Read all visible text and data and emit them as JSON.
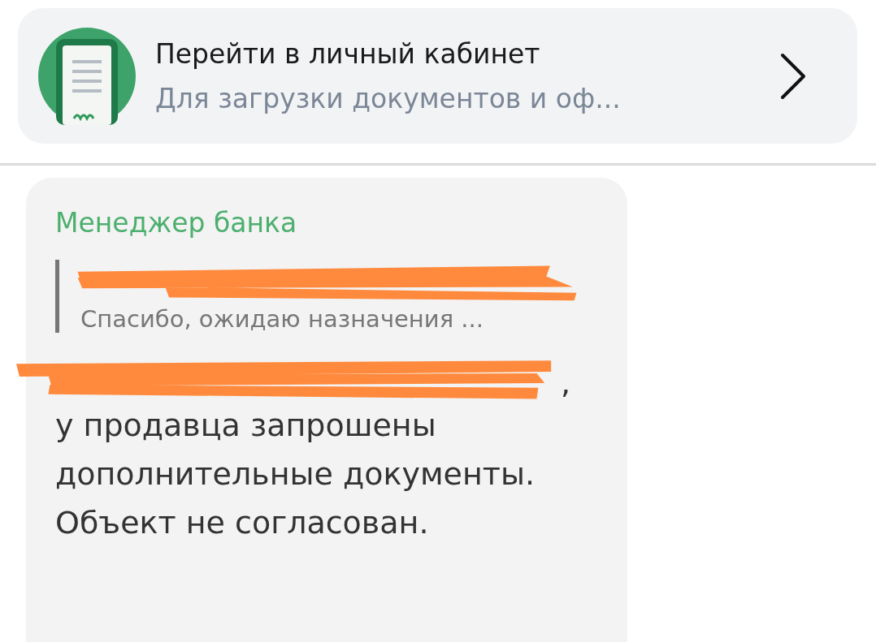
{
  "top_card": {
    "title": "Перейти в личный кабинет",
    "subtitle": "Для загрузки документов и оф..."
  },
  "message": {
    "sender": "Менеджер банка",
    "quote": {
      "text": "Спасибо, ожидаю назначения ..."
    },
    "mention_suffix": ",",
    "body": "у продавца запрошены дополнительные документы. Объект не согласован."
  }
}
